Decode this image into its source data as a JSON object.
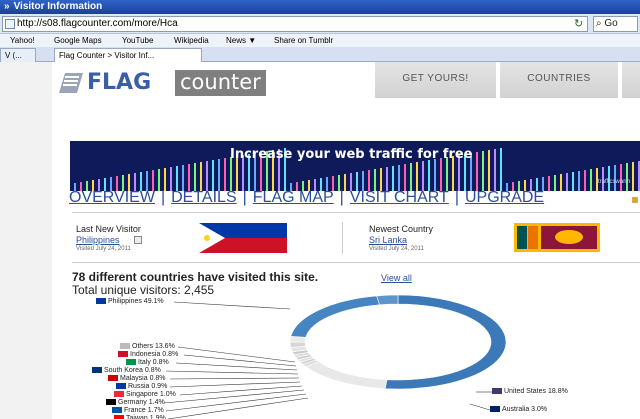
{
  "browser": {
    "title": "Visitor Information",
    "url": "http://s08.flagcounter.com/more/Hca",
    "search_placeholder": "Go",
    "favorites": [
      "Yahoo!",
      "Google Maps",
      "YouTube",
      "Wikipedia",
      "News ▼",
      "Share on Tumblr"
    ],
    "tabs": [
      "V (...",
      "Flag Counter > Visitor Inf..."
    ]
  },
  "site": {
    "logo_flag": "FLAG",
    "logo_counter": "counter",
    "top_buttons": [
      "GET YOURS!",
      "COUNTRIES"
    ],
    "banner_text": "Increase your web traffic for free",
    "banner_small": "trafficswarm",
    "nav": [
      "OVERVIEW",
      "DETAILS",
      "FLAG MAP",
      "VISIT CHART",
      "UPGRADE"
    ]
  },
  "visitors": {
    "last_label": "Last New Visitor",
    "last_country": "Philippines",
    "last_date": "Visited July 24, 2011",
    "newest_label": "Newest Country",
    "newest_country": "Sri Lanka",
    "newest_date": "Visited July 24, 2011"
  },
  "stats": {
    "countries_heading": "78 different countries have visited this site.",
    "view_all": "View all",
    "total": "Total unique visitors: 2,455"
  },
  "chart_data": {
    "type": "pie",
    "slices": [
      {
        "label": "Philippines",
        "value": 49.1
      },
      {
        "label": "Others",
        "value": 13.6
      },
      {
        "label": "Indonesia",
        "value": 0.8
      },
      {
        "label": "Italy",
        "value": 0.8
      },
      {
        "label": "South Korea",
        "value": 0.8
      },
      {
        "label": "Malaysia",
        "value": 0.8
      },
      {
        "label": "Russia",
        "value": 0.9
      },
      {
        "label": "Singapore",
        "value": 1.0
      },
      {
        "label": "Germany",
        "value": 1.4
      },
      {
        "label": "France",
        "value": 1.7
      },
      {
        "label": "Taiwan",
        "value": 1.9
      },
      {
        "label": "United States",
        "value": 18.8
      },
      {
        "label": "Australia",
        "value": 3.0
      }
    ],
    "label_texts": [
      "Philippines  49.1%",
      "Others  13.6%",
      "Indonesia  0.8%",
      "Italy  0.8%",
      "South Korea  0.8%",
      "Malaysia  0.8%",
      "Russia  0.9%",
      "Singapore  1.0%",
      "Germany  1.4%",
      "France  1.7%",
      "Taiwan  1.9%",
      "United States  18.8%",
      "Australia  3.0%"
    ]
  },
  "colors": {
    "link": "#2a4e9b",
    "ring": "#3b79b8",
    "banner": "#0e1a5a",
    "accent_grey": "#7f7f7f"
  }
}
